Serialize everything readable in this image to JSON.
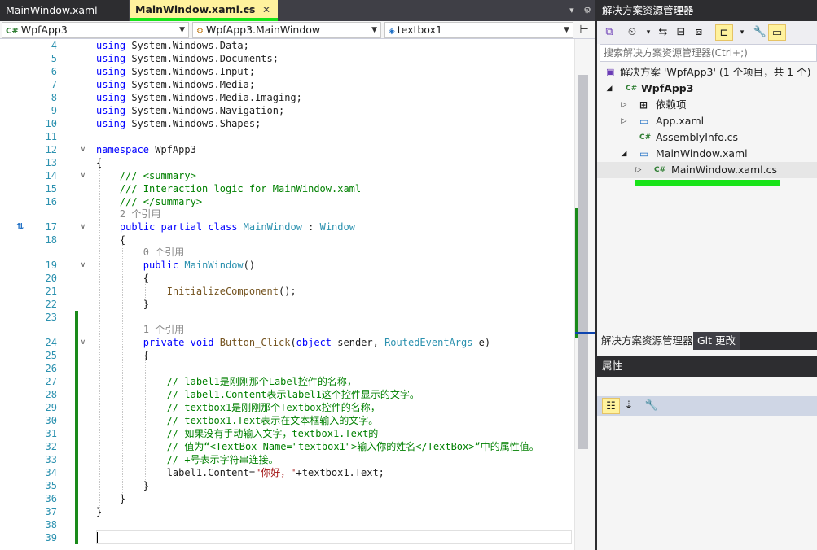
{
  "tabs": {
    "xaml": "MainWindow.xaml",
    "cs": "MainWindow.xaml.cs",
    "pin": "⊸",
    "close": "✕",
    "dropdown": "▾",
    "settings": "⚙"
  },
  "nav": {
    "project": "WpfApp3",
    "class": "WpfApp3.MainWindow",
    "member": "textbox1",
    "split_icon": "⊢"
  },
  "code": {
    "lines": [
      {
        "n": "4",
        "text": "using System.Windows.Data;"
      },
      {
        "n": "5",
        "text": "using System.Windows.Documents;"
      },
      {
        "n": "6",
        "text": "using System.Windows.Input;"
      },
      {
        "n": "7",
        "text": "using System.Windows.Media;"
      },
      {
        "n": "8",
        "text": "using System.Windows.Media.Imaging;"
      },
      {
        "n": "9",
        "text": "using System.Windows.Navigation;"
      },
      {
        "n": "10",
        "text": "using System.Windows.Shapes;"
      },
      {
        "n": "11",
        "text": ""
      },
      {
        "n": "12",
        "text": "namespace WpfApp3"
      },
      {
        "n": "13",
        "text": "{"
      },
      {
        "n": "14",
        "text": "/// <summary>"
      },
      {
        "n": "15",
        "text": "/// Interaction logic for MainWindow.xaml"
      },
      {
        "n": "16",
        "text": "/// </summary>"
      },
      {
        "n": "17",
        "text": "public partial class MainWindow : Window"
      },
      {
        "n": "18",
        "text": "{"
      },
      {
        "n": "19",
        "text": "public MainWindow()"
      },
      {
        "n": "20",
        "text": "{"
      },
      {
        "n": "21",
        "text": "InitializeComponent();"
      },
      {
        "n": "22",
        "text": "}"
      },
      {
        "n": "23",
        "text": ""
      },
      {
        "n": "24",
        "text": "private void Button_Click(object sender, RoutedEventArgs e)"
      },
      {
        "n": "25",
        "text": "{"
      },
      {
        "n": "26",
        "text": ""
      },
      {
        "n": "27",
        "text": "// label1是刚刚那个Label控件的名称，"
      },
      {
        "n": "28",
        "text": "// label1.Content表示label1这个控件显示的文字。"
      },
      {
        "n": "29",
        "text": "// textbox1是刚刚那个Textbox控件的名称，"
      },
      {
        "n": "30",
        "text": "// textbox1.Text表示在文本框输入的文字。"
      },
      {
        "n": "31",
        "text": "// 如果没有手动输入文字，textbox1.Text的"
      },
      {
        "n": "32",
        "text": "// 值为“<TextBox Name=\"textbox1\">输入你的姓名</TextBox>”中的属性值。"
      },
      {
        "n": "33",
        "text": "// +号表示字符串连接。"
      },
      {
        "n": "34",
        "text": "label1.Content=\"你好，\"+textbox1.Text;"
      },
      {
        "n": "35",
        "text": "}"
      },
      {
        "n": "36",
        "text": "}"
      },
      {
        "n": "37",
        "text": "}"
      },
      {
        "n": "38",
        "text": ""
      },
      {
        "n": "39",
        "text": ""
      }
    ],
    "lens": {
      "class_refs": "2 个引用",
      "ctor_refs": "0 个引用",
      "click_refs": "1 个引用"
    },
    "gutter_icon": "⇅"
  },
  "solution_explorer": {
    "title": "解决方案资源管理器",
    "search_placeholder": "搜索解决方案资源管理器(Ctrl+;)",
    "tree": [
      {
        "label": "解决方案 'WpfApp3' (1 个项目，共 1 个)",
        "icon": "▣"
      },
      {
        "label": "WpfApp3",
        "icon": "C#"
      },
      {
        "label": "依赖项",
        "icon": "⊞"
      },
      {
        "label": "App.xaml",
        "icon": "▭"
      },
      {
        "label": "AssemblyInfo.cs",
        "icon": "C#"
      },
      {
        "label": "MainWindow.xaml",
        "icon": "▭"
      },
      {
        "label": "MainWindow.xaml.cs",
        "icon": "C#"
      }
    ],
    "tab_explorer": "解决方案资源管理器",
    "tab_git": "Git 更改"
  },
  "properties": {
    "title": "属性"
  }
}
